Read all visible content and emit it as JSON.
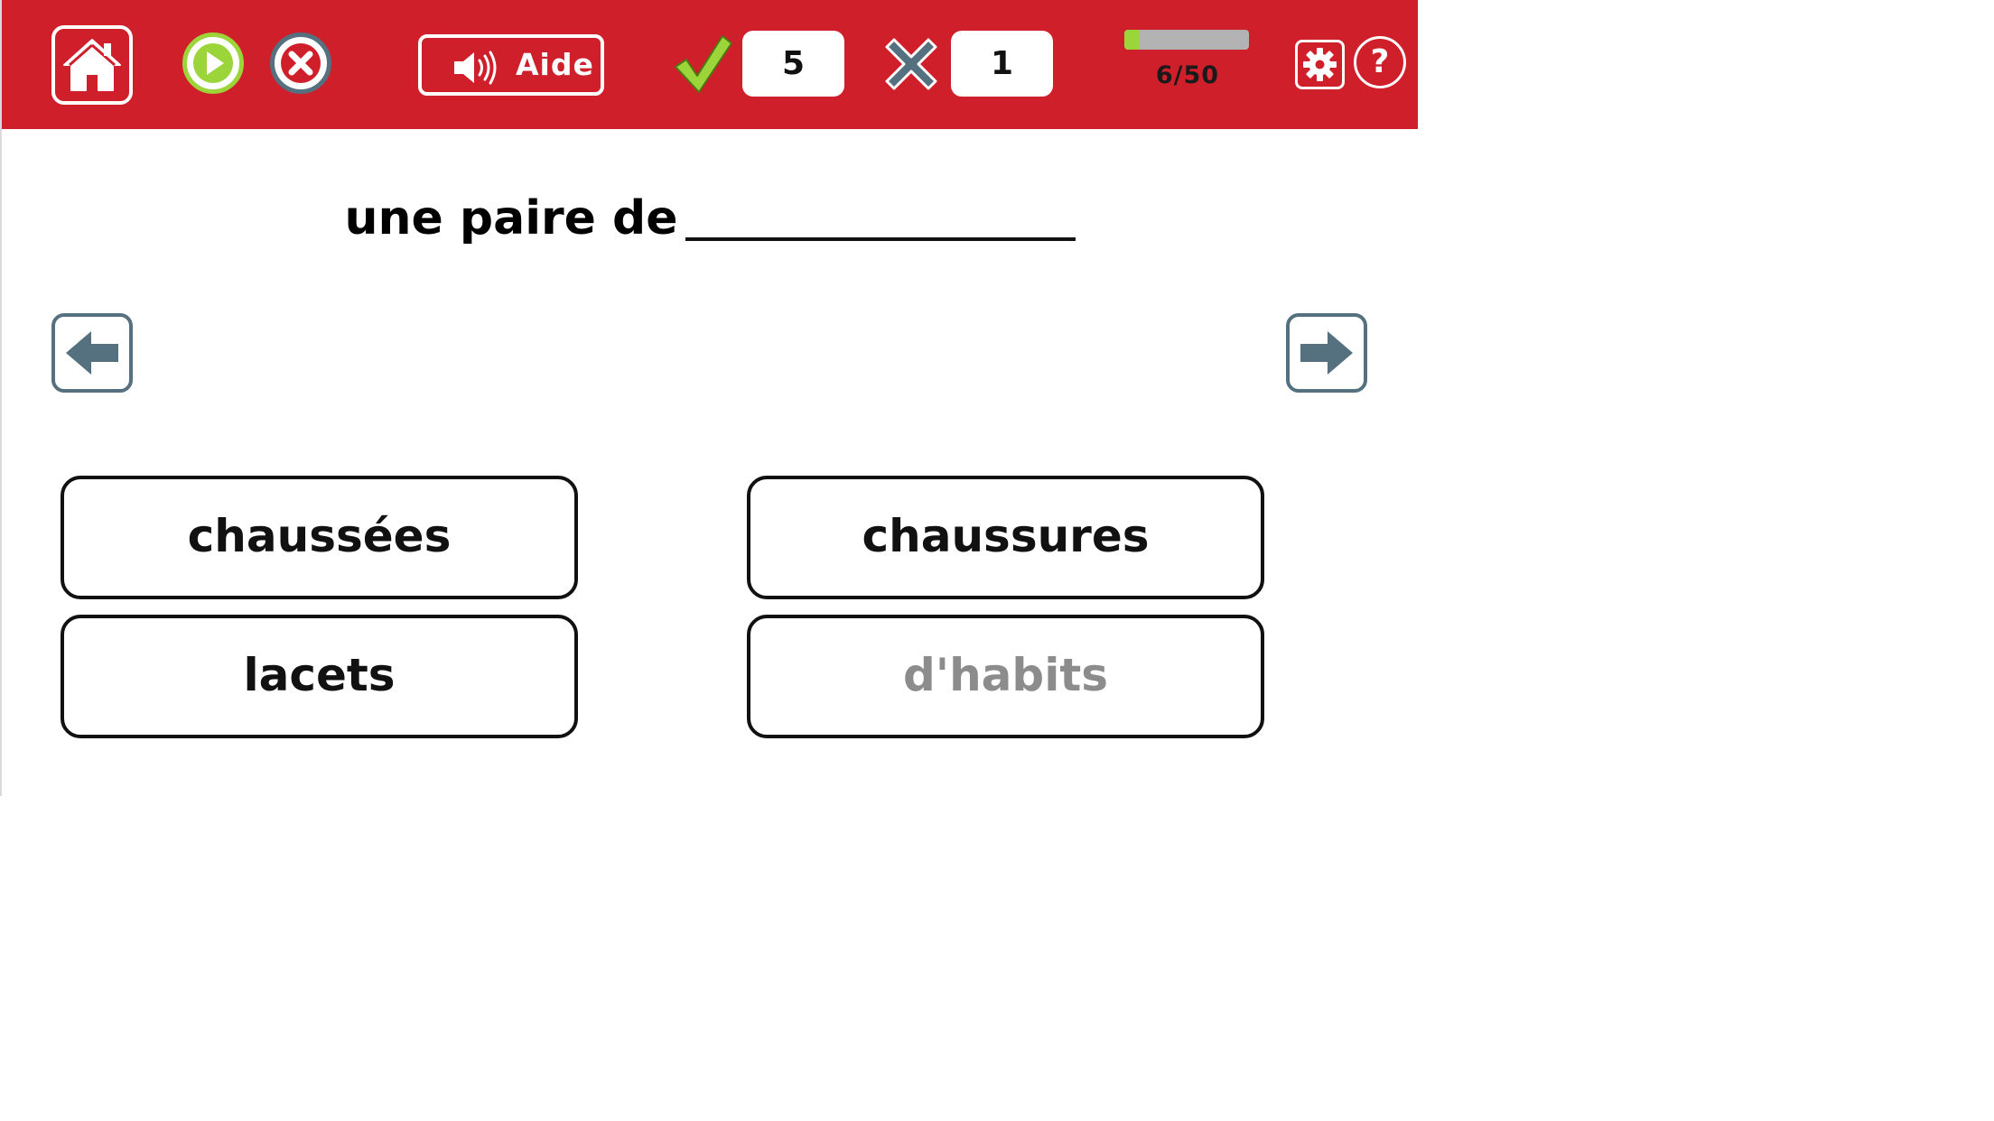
{
  "header": {
    "aide_label": "Aide",
    "correct_count": "5",
    "wrong_count": "1",
    "progress_text": "6/50",
    "progress_fraction": 0.12,
    "help_label": "?",
    "colors": {
      "bar": "#cf1f2b",
      "accent_green": "#9bd53a",
      "icon_gray": "#55707f"
    },
    "icons": {
      "home": "home-icon",
      "play": "play-icon",
      "stop": "close-icon",
      "aide": "speaker-icon",
      "correct": "checkmark-icon",
      "wrong": "cross-icon",
      "settings": "gear-icon",
      "help": "question-icon"
    }
  },
  "question": {
    "text": "une paire de"
  },
  "navigation": {
    "prev_icon": "arrow-left-icon",
    "next_icon": "arrow-right-icon"
  },
  "choices": [
    {
      "label": "chaussées",
      "state": "active"
    },
    {
      "label": "chaussures",
      "state": "active"
    },
    {
      "label": "lacets",
      "state": "active"
    },
    {
      "label": "d'habits",
      "state": "disabled"
    }
  ]
}
